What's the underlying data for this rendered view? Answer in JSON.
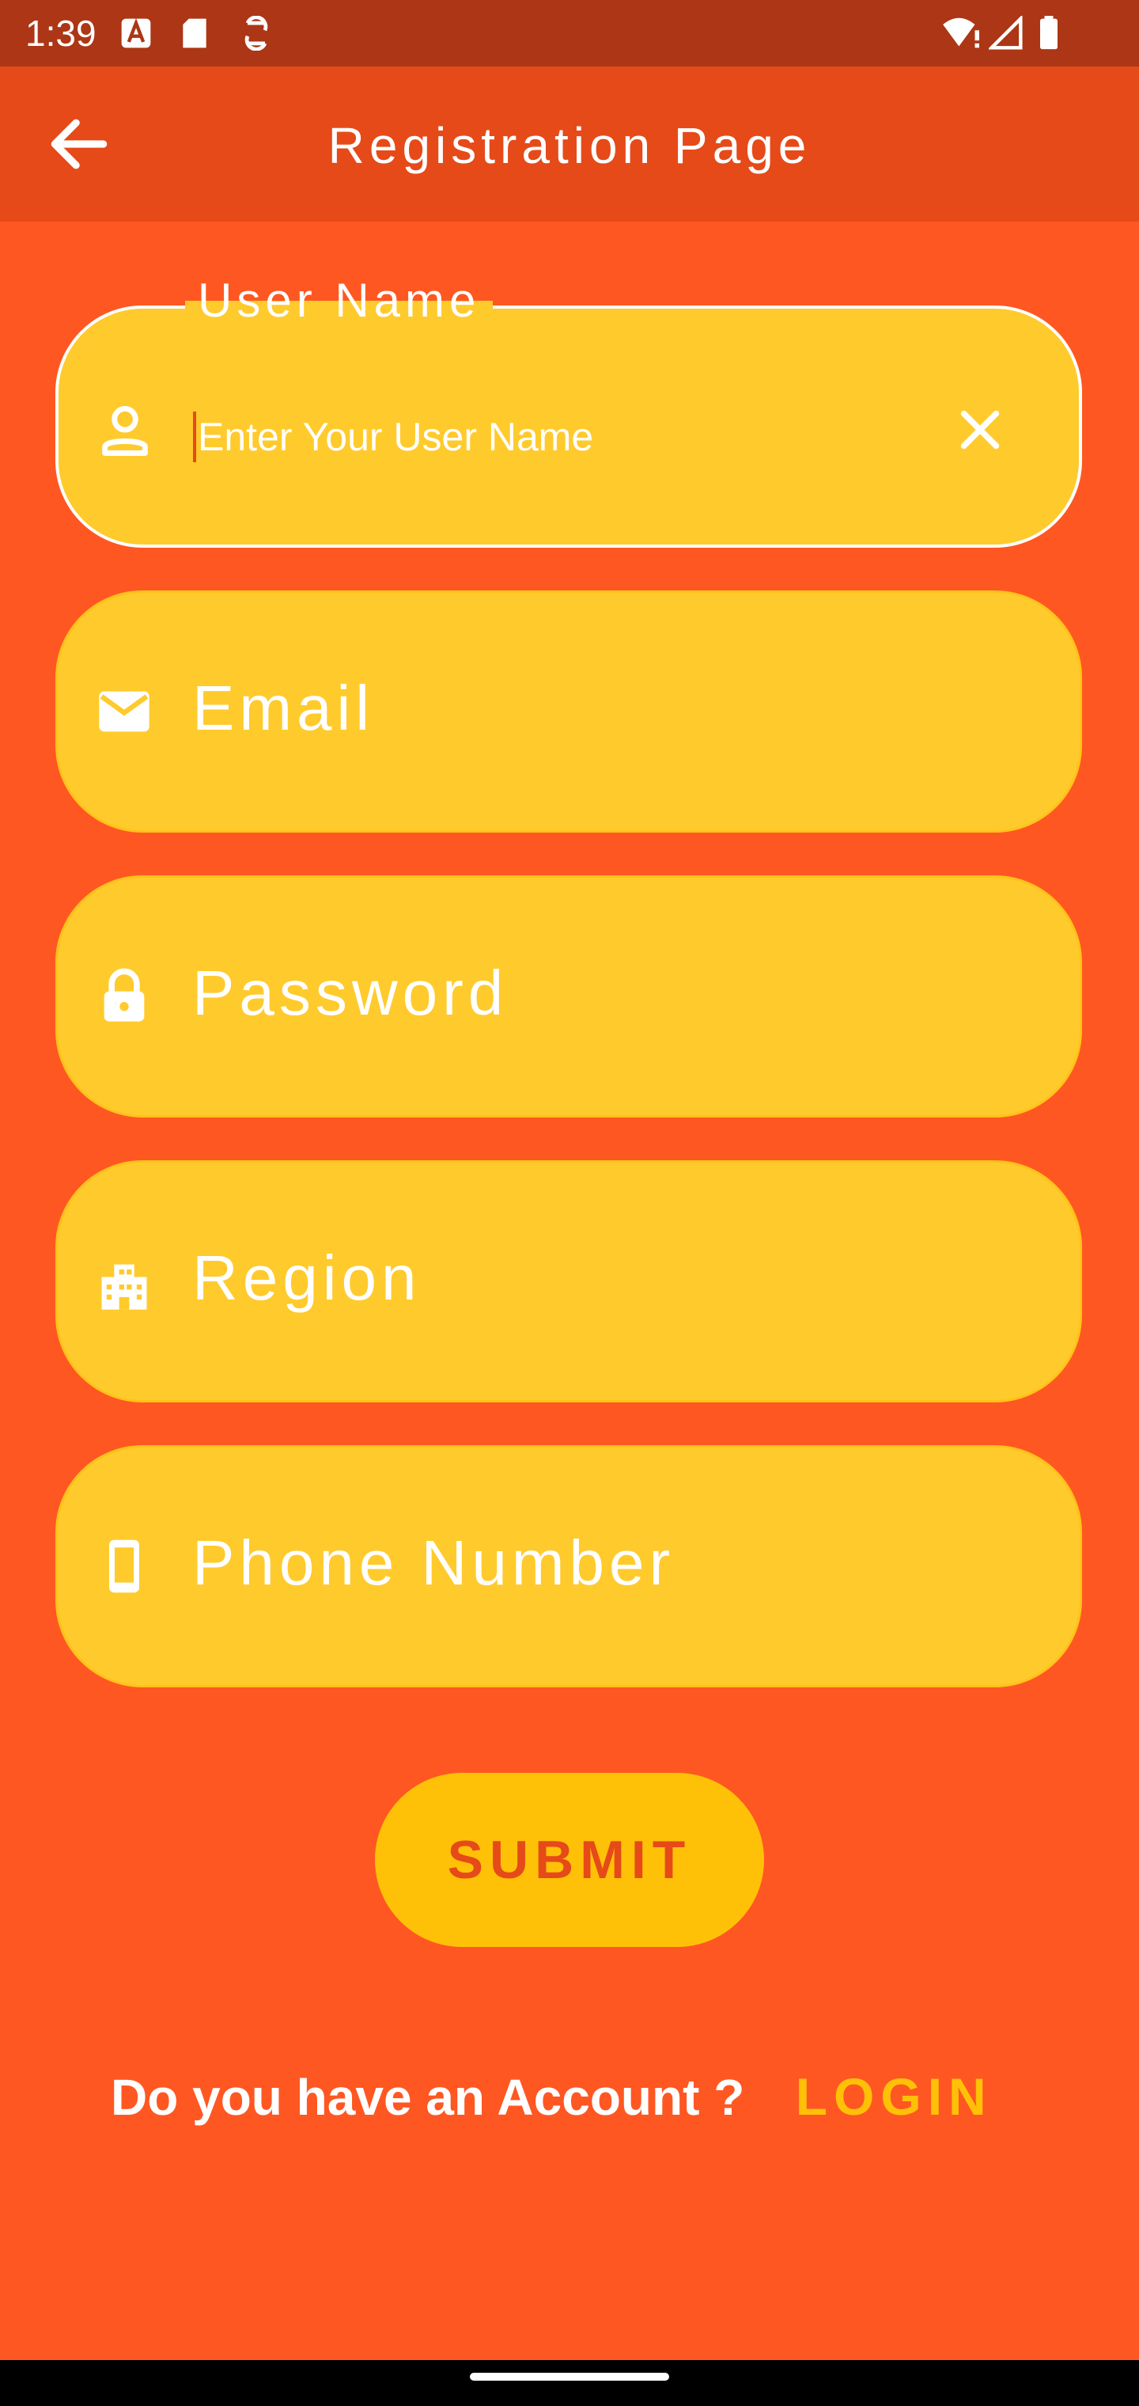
{
  "status": {
    "time": "1:39"
  },
  "app_bar": {
    "title": "Registration Page"
  },
  "form": {
    "username": {
      "label": "User Name",
      "placeholder": "Enter Your User Name"
    },
    "email": {
      "placeholder": "Email"
    },
    "password": {
      "placeholder": "Password"
    },
    "region": {
      "placeholder": "Region"
    },
    "phone": {
      "placeholder": "Phone Number"
    }
  },
  "submit": {
    "label": "SUBMIT"
  },
  "footer": {
    "question": "Do you have an Account ?",
    "login_label": "LOGIN"
  },
  "icons": {
    "back": "arrow-left-icon",
    "username": "person-icon",
    "clear": "close-icon",
    "email": "mail-icon",
    "password": "lock-icon",
    "region": "building-icon",
    "phone": "smartphone-icon"
  },
  "colors": {
    "background": "#FF5722",
    "app_bar": "#E64A19",
    "status_bar": "#AC3615",
    "field": "#FFCA2C",
    "accent": "#FFC107"
  }
}
